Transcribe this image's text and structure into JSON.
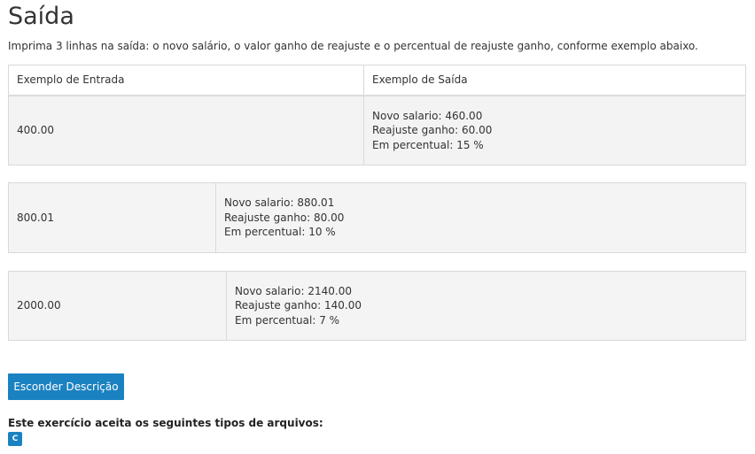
{
  "section": {
    "title": "Saída",
    "description": "Imprima 3 linhas na saída: o novo salário, o valor ganho de reajuste e o percentual de reajuste ganho, conforme exemplo abaixo."
  },
  "table": {
    "headers": [
      "Exemplo de Entrada",
      "Exemplo de Saída"
    ],
    "examples": [
      {
        "input": "400.00",
        "output": [
          "Novo salario: 460.00",
          "Reajuste ganho: 60.00",
          "Em percentual: 15 %"
        ]
      },
      {
        "input": "800.01",
        "output": [
          "Novo salario: 880.01",
          "Reajuste ganho: 80.00",
          "Em percentual: 10 %"
        ]
      },
      {
        "input": "2000.00",
        "output": [
          "Novo salario: 2140.00",
          "Reajuste ganho: 140.00",
          "Em percentual: 7 %"
        ]
      }
    ]
  },
  "actions": {
    "hide_description_label": "Esconder Descrição"
  },
  "file_types": {
    "label": "Este exercício aceita os seguintes tipos de arquivos:",
    "types": [
      "C"
    ]
  },
  "colors": {
    "accent": "#1b82c1",
    "row_background": "#f3f3f3",
    "border": "#d9d9d9"
  }
}
